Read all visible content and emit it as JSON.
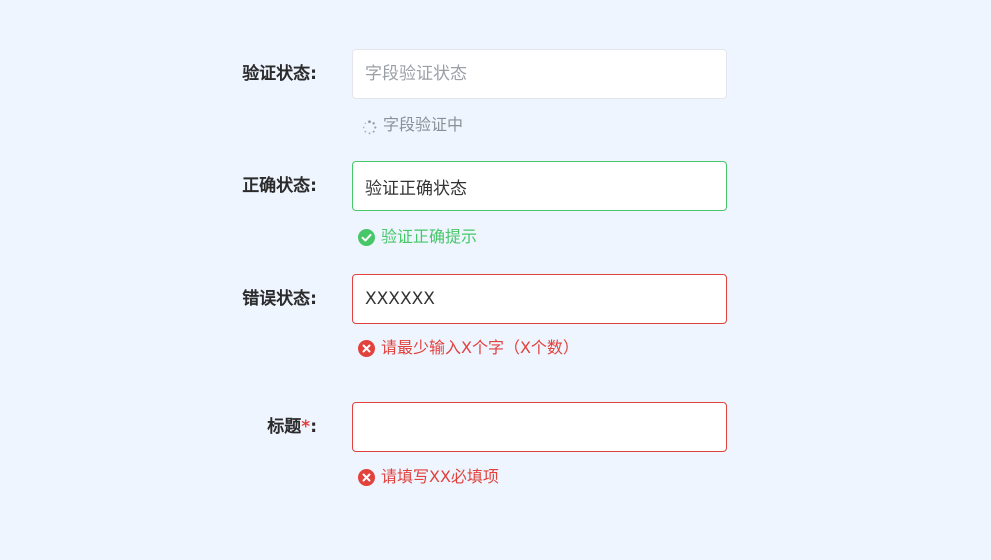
{
  "form": {
    "validating": {
      "label": "验证状态:",
      "placeholder": "字段验证状态",
      "value": "",
      "hint": "字段验证中"
    },
    "success": {
      "label": "正确状态:",
      "value": "验证正确状态",
      "hint": "验证正确提示"
    },
    "error": {
      "label": "错误状态:",
      "value": "XXXXXX",
      "hint": "请最少输入X个字（X个数）"
    },
    "title": {
      "label": "标题",
      "required_mark": "*",
      "label_suffix": ":",
      "value": "",
      "hint": "请填写XX必填项"
    }
  },
  "colors": {
    "background": "#eef5ff",
    "success": "#47c768",
    "error": "#e2413c",
    "muted": "#8b9097"
  },
  "icons": {
    "pending": "loading-spinner-icon",
    "success": "check-circle-icon",
    "error": "x-circle-icon"
  }
}
